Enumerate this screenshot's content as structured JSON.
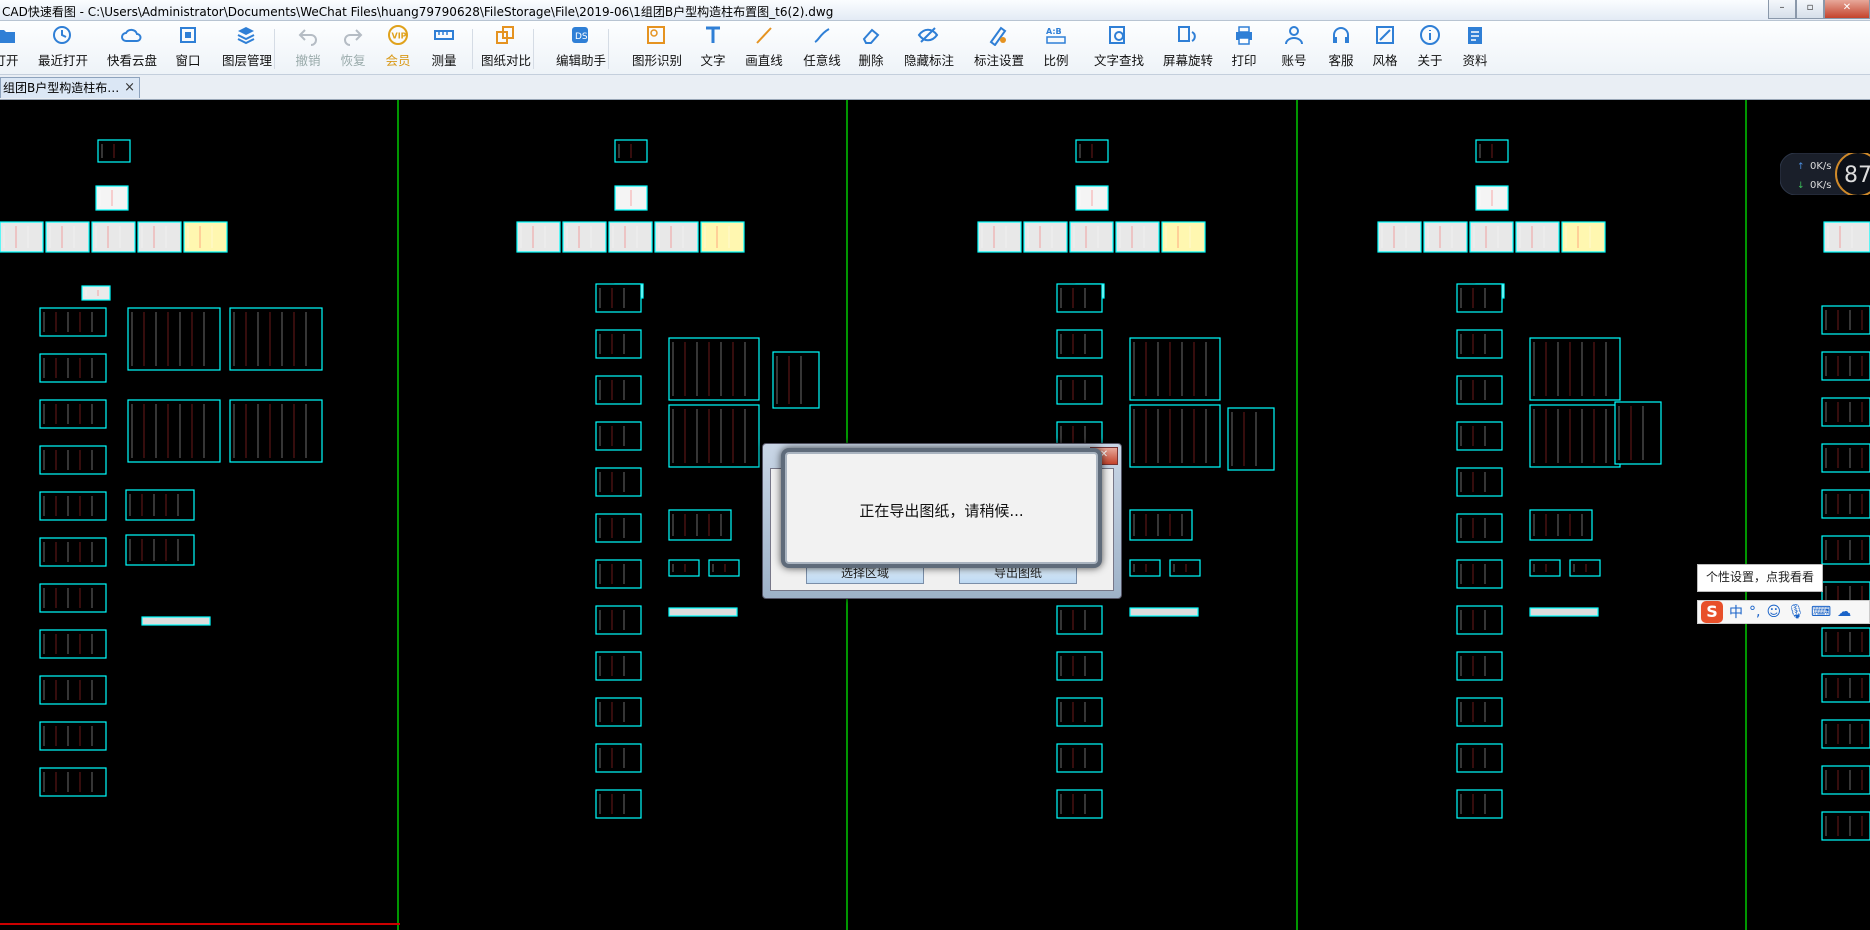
{
  "window": {
    "title": "CAD快速看图 - C:\\Users\\Administrator\\Documents\\WeChat Files\\huang79790628\\FileStorage\\File\\2019-06\\1组团B户型构造柱布置图_t6(2).dwg"
  },
  "toolbar": {
    "items": [
      {
        "label": "打开",
        "icon": "folder-open-icon"
      },
      {
        "label": "最近打开",
        "icon": "history-icon"
      },
      {
        "label": "快看云盘",
        "icon": "cloud-icon"
      },
      {
        "label": "窗口",
        "icon": "window-icon"
      },
      {
        "label": "图层管理",
        "icon": "layers-icon"
      },
      {
        "label": "撤销",
        "icon": "undo-icon"
      },
      {
        "label": "恢复",
        "icon": "redo-icon"
      },
      {
        "label": "会员",
        "icon": "vip-icon"
      },
      {
        "label": "测量",
        "icon": "ruler-icon"
      },
      {
        "label": "图纸对比",
        "icon": "compare-icon"
      },
      {
        "label": "编辑助手",
        "icon": "edit-assistant-icon"
      },
      {
        "label": "图形识别",
        "icon": "shape-recognize-icon"
      },
      {
        "label": "文字",
        "icon": "text-icon"
      },
      {
        "label": "画直线",
        "icon": "line-icon"
      },
      {
        "label": "任意线",
        "icon": "freehand-icon"
      },
      {
        "label": "删除",
        "icon": "eraser-icon"
      },
      {
        "label": "隐藏标注",
        "icon": "eye-hide-icon"
      },
      {
        "label": "标注设置",
        "icon": "annotation-settings-icon"
      },
      {
        "label": "比例",
        "icon": "scale-icon"
      },
      {
        "label": "文字查找",
        "icon": "text-search-icon"
      },
      {
        "label": "屏幕旋转",
        "icon": "rotate-screen-icon"
      },
      {
        "label": "打印",
        "icon": "printer-icon"
      },
      {
        "label": "账号",
        "icon": "user-icon"
      },
      {
        "label": "客服",
        "icon": "headset-icon"
      },
      {
        "label": "风格",
        "icon": "style-icon"
      },
      {
        "label": "关于",
        "icon": "info-icon"
      },
      {
        "label": "资料",
        "icon": "document-icon"
      }
    ]
  },
  "tabs": [
    {
      "label": "组团B户型构造柱布…",
      "close": "×"
    }
  ],
  "dialog": {
    "message": "正在导出图纸，请稍候...",
    "buttons": [
      "选择区域",
      "导出图纸"
    ]
  },
  "network": {
    "upload": "0K/s",
    "download": "0K/s",
    "score": "87"
  },
  "ime": {
    "tooltip": "个性设置，点我看看",
    "logo": "S",
    "mode": "中"
  },
  "colors": {
    "canvas_bg": "#000000",
    "drawing_cyan": "#00ffff",
    "divider_green": "#00c800",
    "accent_blue": "#1a63c8"
  }
}
